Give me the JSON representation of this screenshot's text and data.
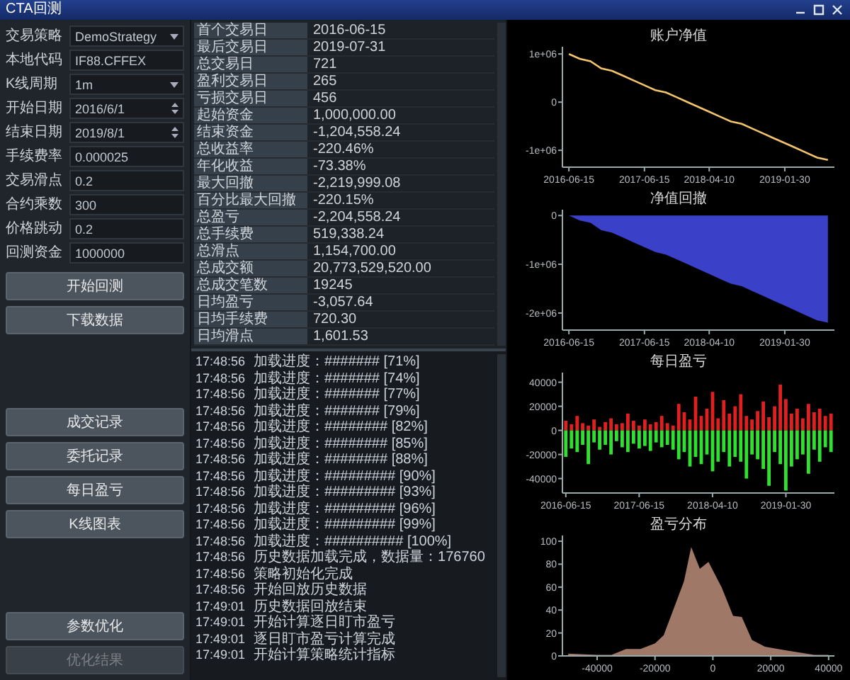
{
  "window": {
    "title": "CTA回测"
  },
  "settings": [
    {
      "label": "交易策略",
      "value": "DemoStrategy",
      "kind": "dropdown"
    },
    {
      "label": "本地代码",
      "value": "IF88.CFFEX",
      "kind": "text"
    },
    {
      "label": "K线周期",
      "value": "1m",
      "kind": "dropdown"
    },
    {
      "label": "开始日期",
      "value": "2016/6/1",
      "kind": "date"
    },
    {
      "label": "结束日期",
      "value": "2019/8/1",
      "kind": "date"
    },
    {
      "label": "手续费率",
      "value": "0.000025",
      "kind": "text"
    },
    {
      "label": "交易滑点",
      "value": "0.2",
      "kind": "text"
    },
    {
      "label": "合约乘数",
      "value": "300",
      "kind": "text"
    },
    {
      "label": "价格跳动",
      "value": "0.2",
      "kind": "text"
    },
    {
      "label": "回测资金",
      "value": "1000000",
      "kind": "text"
    }
  ],
  "button_groups": [
    [
      {
        "label": "开始回测",
        "disabled": false
      },
      {
        "label": "下载数据",
        "disabled": false
      }
    ],
    [
      {
        "label": "成交记录",
        "disabled": false
      },
      {
        "label": "委托记录",
        "disabled": false
      },
      {
        "label": "每日盈亏",
        "disabled": false
      },
      {
        "label": "K线图表",
        "disabled": false
      }
    ],
    [
      {
        "label": "参数优化",
        "disabled": false
      },
      {
        "label": "优化结果",
        "disabled": true
      }
    ]
  ],
  "statistics": [
    {
      "label": "首个交易日",
      "value": "2016-06-15"
    },
    {
      "label": "最后交易日",
      "value": "2019-07-31"
    },
    {
      "label": "总交易日",
      "value": "721"
    },
    {
      "label": "盈利交易日",
      "value": "265"
    },
    {
      "label": "亏损交易日",
      "value": "456"
    },
    {
      "label": "起始资金",
      "value": "1,000,000.00"
    },
    {
      "label": "结束资金",
      "value": "-1,204,558.24"
    },
    {
      "label": "总收益率",
      "value": "-220.46%"
    },
    {
      "label": "年化收益",
      "value": "-73.38%"
    },
    {
      "label": "最大回撤",
      "value": "-2,219,999.08"
    },
    {
      "label": "百分比最大回撤",
      "value": "-220.15%"
    },
    {
      "label": "总盈亏",
      "value": "-2,204,558.24"
    },
    {
      "label": "总手续费",
      "value": "519,338.24"
    },
    {
      "label": "总滑点",
      "value": "1,154,700.00"
    },
    {
      "label": "总成交额",
      "value": "20,773,529,520.00"
    },
    {
      "label": "总成交笔数",
      "value": "19245"
    },
    {
      "label": "日均盈亏",
      "value": "-3,057.64"
    },
    {
      "label": "日均手续费",
      "value": "720.30"
    },
    {
      "label": "日均滑点",
      "value": "1,601.53"
    }
  ],
  "log": [
    {
      "time": "17:48:56",
      "text": "加载进度：####### [71%]"
    },
    {
      "time": "17:48:56",
      "text": "加载进度：####### [74%]"
    },
    {
      "time": "17:48:56",
      "text": "加载进度：####### [77%]"
    },
    {
      "time": "17:48:56",
      "text": "加载进度：####### [79%]"
    },
    {
      "time": "17:48:56",
      "text": "加载进度：######## [82%]"
    },
    {
      "time": "17:48:56",
      "text": "加载进度：######## [85%]"
    },
    {
      "time": "17:48:56",
      "text": "加载进度：######## [88%]"
    },
    {
      "time": "17:48:56",
      "text": "加载进度：######### [90%]"
    },
    {
      "time": "17:48:56",
      "text": "加载进度：######### [93%]"
    },
    {
      "time": "17:48:56",
      "text": "加载进度：######### [96%]"
    },
    {
      "time": "17:48:56",
      "text": "加载进度：######### [99%]"
    },
    {
      "time": "17:48:56",
      "text": "加载进度：########## [100%]"
    },
    {
      "time": "17:48:56",
      "text": "历史数据加载完成，数据量：176760"
    },
    {
      "time": "17:48:56",
      "text": "策略初始化完成"
    },
    {
      "time": "17:48:56",
      "text": "开始回放历史数据"
    },
    {
      "time": "17:49:01",
      "text": "历史数据回放结束"
    },
    {
      "time": "17:49:01",
      "text": "开始计算逐日盯市盈亏"
    },
    {
      "time": "17:49:01",
      "text": "逐日盯市盈亏计算完成"
    },
    {
      "time": "17:49:01",
      "text": "开始计算策略统计指标"
    }
  ],
  "charts": [
    {
      "chart_data": {
        "type": "line",
        "title": "账户净值",
        "categories": [
          "2016-06-15",
          null,
          null,
          null,
          null,
          null,
          null,
          "2017-06-15",
          null,
          null,
          null,
          null,
          null,
          "2018-04-10",
          null,
          null,
          null,
          null,
          null,
          null,
          "2019-01-30",
          null,
          null,
          null,
          null
        ],
        "series": [
          {
            "color": "#f2c46b",
            "values": [
              1000000,
              900000,
              850000,
              700000,
              650000,
              550000,
              450000,
              350000,
              250000,
              200000,
              100000,
              0,
              -100000,
              -200000,
              -300000,
              -400000,
              -450000,
              -550000,
              -650000,
              -750000,
              -850000,
              -950000,
              -1050000,
              -1150000,
              -1200000
            ]
          }
        ],
        "ylim": [
          -1350000,
          1150000
        ],
        "yticks": [
          {
            "value": 1000000,
            "label": "1e+06"
          },
          {
            "value": 0,
            "label": "0"
          },
          {
            "value": -1000000,
            "label": "-1e+06"
          }
        ]
      }
    },
    {
      "chart_data": {
        "type": "area",
        "title": "净值回撤",
        "categories": [
          "2016-06-15",
          null,
          null,
          null,
          null,
          null,
          null,
          "2017-06-15",
          null,
          null,
          null,
          null,
          null,
          "2018-04-10",
          null,
          null,
          null,
          null,
          null,
          null,
          "2019-01-30",
          null,
          null,
          null,
          null
        ],
        "series": [
          {
            "color": "#3a40c8",
            "values": [
              0,
              -100000,
              -150000,
              -300000,
              -350000,
              -450000,
              -550000,
              -650000,
              -750000,
              -800000,
              -900000,
              -1000000,
              -1100000,
              -1200000,
              -1300000,
              -1400000,
              -1450000,
              -1550000,
              -1650000,
              -1750000,
              -1850000,
              -1950000,
              -2050000,
              -2150000,
              -2200000
            ]
          }
        ],
        "ylim": [
          -2350000,
          120000
        ],
        "yticks": [
          {
            "value": 0,
            "label": "0"
          },
          {
            "value": -1000000,
            "label": "-1e+06"
          },
          {
            "value": -2000000,
            "label": "-2e+06"
          }
        ]
      }
    },
    {
      "chart_data": {
        "type": "bar",
        "title": "每日盈亏",
        "categories": [
          "2016-06-15",
          null,
          null,
          null,
          null,
          null,
          null,
          null,
          null,
          null,
          null,
          null,
          null,
          "2017-06-15",
          null,
          null,
          null,
          null,
          null,
          null,
          null,
          null,
          null,
          null,
          null,
          null,
          "2018-04-10",
          null,
          null,
          null,
          null,
          null,
          null,
          null,
          null,
          null,
          null,
          null,
          null,
          "2019-01-30",
          null,
          null,
          null,
          null,
          null,
          null,
          null,
          null
        ],
        "series": [
          {
            "color": "#e02020",
            "values": [
              8000,
              5000,
              12000,
              6000,
              4000,
              9000,
              3000,
              7000,
              10000,
              5000,
              6000,
              14000,
              8000,
              4000,
              9000,
              5000,
              7000,
              12000,
              6000,
              4000,
              22000,
              15000,
              9000,
              28000,
              12000,
              18000,
              32000,
              10000,
              25000,
              14000,
              20000,
              30000,
              12000,
              9000,
              16000,
              24000,
              11000,
              20000,
              38000,
              26000,
              14000,
              18000,
              10000,
              22000,
              15000,
              18000,
              12000,
              14000
            ]
          },
          {
            "color": "#30e030",
            "values": [
              -22000,
              -15000,
              -18000,
              -12000,
              -28000,
              -10000,
              -16000,
              -12000,
              -20000,
              -9000,
              -14000,
              -18000,
              -11000,
              -15000,
              -13000,
              -17000,
              -10000,
              -14000,
              -12000,
              -16000,
              -24000,
              -18000,
              -30000,
              -22000,
              -28000,
              -20000,
              -34000,
              -26000,
              -18000,
              -30000,
              -22000,
              -26000,
              -40000,
              -20000,
              -24000,
              -32000,
              -46000,
              -18000,
              -28000,
              -50000,
              -30000,
              -24000,
              -20000,
              -36000,
              -16000,
              -26000,
              -14000,
              -18000
            ]
          }
        ],
        "ylim": [
          -52000,
          48000
        ],
        "stacked": true,
        "yticks": [
          40000,
          20000,
          0,
          -20000,
          -40000
        ]
      }
    },
    {
      "chart_data": {
        "type": "area",
        "title": "盈亏分布",
        "x": [
          -50000,
          -40000,
          -35000,
          -30000,
          -25000,
          -20000,
          -17000,
          -13000,
          -10000,
          -7500,
          -4500,
          -1500,
          3000,
          7000,
          10000,
          13500,
          18000,
          25000,
          35000,
          40000
        ],
        "series": [
          {
            "color": "#a07868",
            "values": [
              2,
              1,
              1,
              6,
              6,
              11,
              18,
              45,
              65,
              95,
              76,
              82,
              60,
              35,
              34,
              14,
              8,
              5,
              1,
              1
            ]
          }
        ],
        "xlim": [
          -52000,
          42000
        ],
        "ylim": [
          0,
          105
        ],
        "xticks": [
          -40000,
          -20000,
          0,
          20000,
          40000
        ],
        "yticks": [
          0,
          20,
          40,
          60,
          80,
          100
        ]
      }
    }
  ]
}
